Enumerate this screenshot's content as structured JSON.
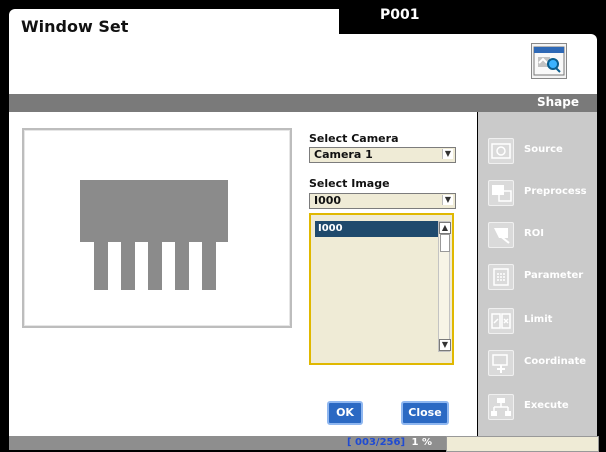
{
  "window": {
    "title": "Window Set",
    "page_code": "P001",
    "tool_icon": "camera-magnifier-icon"
  },
  "band": {
    "label": "Shape"
  },
  "camera": {
    "label": "Select Camera",
    "selected": "Camera 1"
  },
  "image": {
    "label": "Select Image",
    "selected": "I000",
    "list_items": [
      "I000"
    ]
  },
  "buttons": {
    "ok": "OK",
    "close": "Close"
  },
  "sidebar": {
    "items": [
      {
        "label": "Source",
        "icon": "source-icon"
      },
      {
        "label": "Preprocess",
        "icon": "preprocess-icon"
      },
      {
        "label": "ROI",
        "icon": "roi-icon"
      },
      {
        "label": "Parameter",
        "icon": "parameter-icon"
      },
      {
        "label": "Limit",
        "icon": "limit-icon"
      },
      {
        "label": "Coordinate",
        "icon": "coordinate-icon"
      },
      {
        "label": "Execute",
        "icon": "execute-icon"
      }
    ]
  },
  "status": {
    "counter": "[ 003/256]",
    "percent": "1 %"
  },
  "colors": {
    "accent_blue": "#2b69c3",
    "selection_blue": "#1f4a6d",
    "list_bg": "#efebd6",
    "highlight_border": "#e0b800",
    "band_gray": "#7a7a7a",
    "sidebar_gray": "#cacaca"
  }
}
